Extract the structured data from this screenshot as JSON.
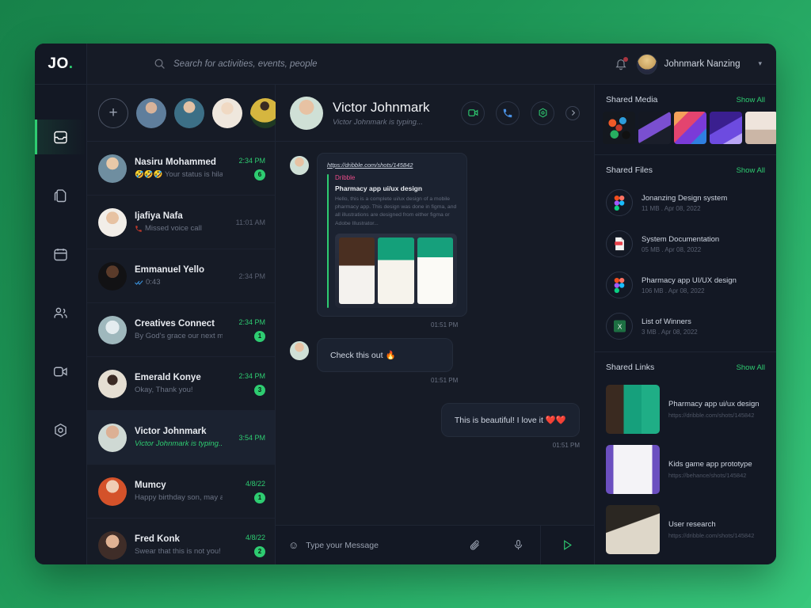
{
  "brand": {
    "name": "JO",
    "dot": "."
  },
  "search": {
    "placeholder": "Search for activities, events, people",
    "icon": "search-icon"
  },
  "account": {
    "name": "Johnmark Nanzing",
    "caret": "▾",
    "notification_icon": "bell-icon"
  },
  "rail": {
    "items": [
      {
        "icon": "inbox-icon",
        "name": "inbox",
        "active": true
      },
      {
        "icon": "files-icon",
        "name": "files",
        "active": false
      },
      {
        "icon": "calendar-icon",
        "name": "calendar",
        "active": false
      },
      {
        "icon": "contacts-icon",
        "name": "contacts",
        "active": false
      },
      {
        "icon": "video-icon",
        "name": "video",
        "active": false
      },
      {
        "icon": "settings-icon",
        "name": "settings",
        "active": false
      }
    ]
  },
  "stories": {
    "add_label": "+",
    "count": 4
  },
  "chats": [
    {
      "name": "Nasiru Mohammed",
      "preview": "🤣🤣🤣 Your status is hilarious",
      "time": "2:34 PM",
      "badge": "6",
      "active": false,
      "typing": false
    },
    {
      "name": "Ijafiya Nafa",
      "preview": "Missed voice call",
      "time": "11:01 AM",
      "badge": "",
      "active": false,
      "typing": false,
      "time_muted": true
    },
    {
      "name": "Emmanuel Yello",
      "preview": "0:43",
      "time": "2:34 PM",
      "badge": "",
      "active": false,
      "typing": false,
      "time_muted": true
    },
    {
      "name": "Creatives Connect",
      "preview": "By God's grace our next meeting will b...",
      "time": "2:34 PM",
      "badge": "1",
      "active": false,
      "typing": false
    },
    {
      "name": "Emerald Konye",
      "preview": "Okay, Thank you!",
      "time": "2:34 PM",
      "badge": "3",
      "active": false,
      "typing": false
    },
    {
      "name": "Victor Johnmark",
      "preview": "Victor Johnmark is typing...",
      "time": "3:54 PM",
      "badge": "",
      "active": true,
      "typing": true
    },
    {
      "name": "Mumcy",
      "preview": "Happy birthday son, may all your wis...",
      "time": "4/8/22",
      "badge": "1",
      "active": false,
      "typing": false
    },
    {
      "name": "Fred Konk",
      "preview": "Swear that this is not you!",
      "time": "4/8/22",
      "badge": "2",
      "active": false,
      "typing": false
    }
  ],
  "conversation": {
    "title": "Victor Johnmark",
    "subtitle": "Victor Johnmark is typing...",
    "actions": [
      {
        "name": "video-call-button",
        "icon": "video-camera-icon"
      },
      {
        "name": "voice-call-button",
        "icon": "phone-icon"
      },
      {
        "name": "more-options-button",
        "icon": "hexagon-settings-icon"
      },
      {
        "name": "expand-panel-button",
        "icon": "chevron-right-icon"
      }
    ],
    "messages": [
      {
        "type": "link-card",
        "url": "https://dribble.com/shots/145842",
        "site": "Dribble",
        "title": "Pharmacy app ui/ux design",
        "description": "Hello, this is a complete ui/ux design of a mobile pharmacy app. This design was done in figma, and all illustrations are designed from either figma or Adobe Illustrator...",
        "time": "01:51 PM",
        "direction": "in"
      },
      {
        "type": "text",
        "text": "Check this out 🔥",
        "time": "01:51 PM",
        "direction": "in"
      },
      {
        "type": "text",
        "text": "This is beautiful! I love it ❤️❤️",
        "time": "01:51 PM",
        "direction": "out"
      }
    ],
    "composer": {
      "placeholder": "Type your Message",
      "emoji_icon": "emoji-icon",
      "attach_icon": "paperclip-icon",
      "mic_icon": "microphone-icon",
      "send_icon": "send-icon"
    }
  },
  "right_panel": {
    "shared_media": {
      "title": "Shared Media",
      "show_all": "Show All",
      "thumbs": 5
    },
    "shared_files": {
      "title": "Shared Files",
      "show_all": "Show All",
      "items": [
        {
          "name": "Jonanzing Design system",
          "meta": "11 MB . Apr 08, 2022",
          "icon": "figma-icon"
        },
        {
          "name": "System Documentation",
          "meta": "05 MB . Apr 08, 2022",
          "icon": "pdf-icon"
        },
        {
          "name": "Pharmacy app UI/UX design",
          "meta": "106 MB . Apr 08, 2022",
          "icon": "figma-icon"
        },
        {
          "name": "List of Winners",
          "meta": "3 MB . Apr 08, 2022",
          "icon": "excel-icon"
        }
      ]
    },
    "shared_links": {
      "title": "Shared Links",
      "show_all": "Show All",
      "items": [
        {
          "title": "Pharmacy app ui/ux design",
          "url": "https://dribble.com/shots/145842"
        },
        {
          "title": "Kids game app prototype",
          "url": "https://behance/shots/145842"
        },
        {
          "title": "User research",
          "url": "https://dribble.com/shots/145842"
        }
      ]
    }
  },
  "colors": {
    "background_green_dark": "#17824a",
    "background_green_light": "#38c87c",
    "panel": "#161b26",
    "rail": "#131824",
    "accent": "#2ecc71",
    "dribbble_pink": "#ea4c89",
    "blue": "#4a90e2",
    "red": "#e8414b"
  }
}
